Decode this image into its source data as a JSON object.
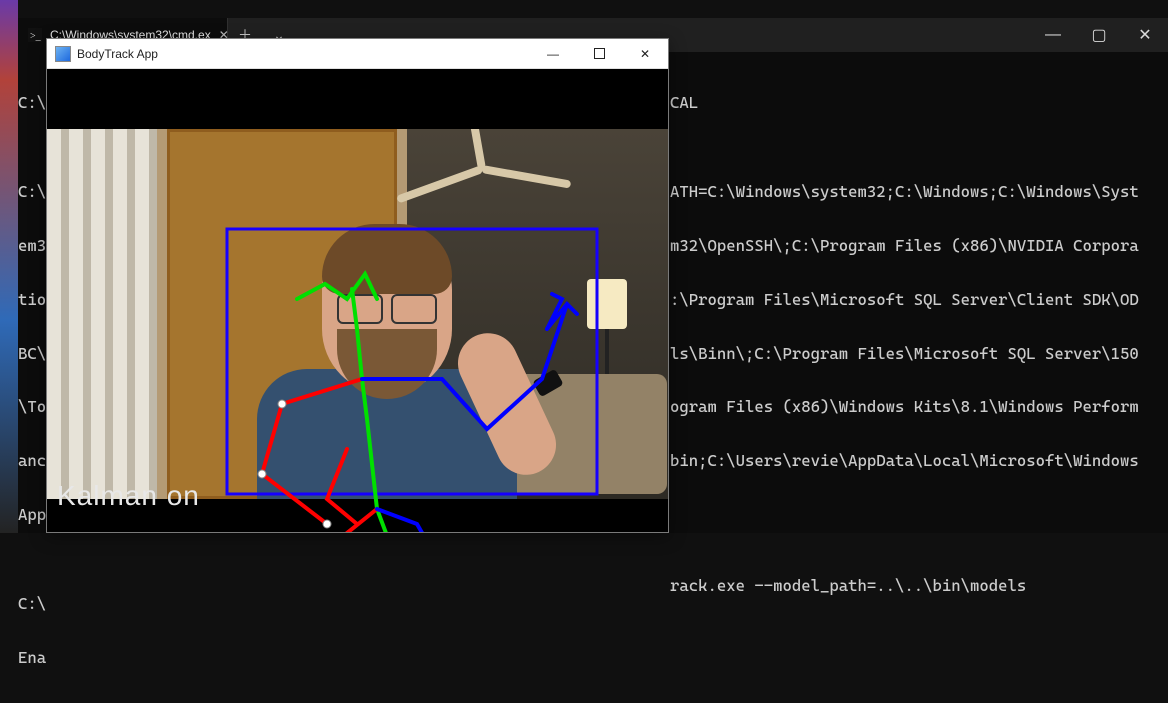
{
  "terminal": {
    "tab": {
      "icon": "cmd-icon",
      "title": "C:\\Windows\\system32\\cmd.ex"
    },
    "left_fragments": [
      "C:\\",
      "",
      "C:\\",
      "em3",
      "tio",
      "BC\\",
      "\\To",
      "anc",
      "App",
      "",
      "C:\\",
      "Ena"
    ],
    "right_fragments": [
      "CAL",
      "",
      "ATH=C:\\Windows\\system32;C:\\Windows;C:\\Windows\\Syst",
      "m32\\OpenSSH\\;C:\\Program Files (x86)\\NVIDIA Corpora",
      ":\\Program Files\\Microsoft SQL Server\\Client SDK\\OD",
      "ls\\Binn\\;C:\\Program Files\\Microsoft SQL Server\\150",
      "ogram Files (x86)\\Windows Kits\\8.1\\Windows Perform",
      "bin;C:\\Users\\revie\\AppData\\Local\\Microsoft\\Windows",
      "",
      "",
      "rack.exe --model_path=..\\..\\bin\\models",
      ""
    ]
  },
  "app": {
    "title": "BodyTrack App",
    "status_text": "Kalman on",
    "bbox_color": "#1600ff",
    "skel_colors": {
      "left": "#ff0000",
      "right": "#0000ff",
      "center": "#00e000"
    }
  },
  "window_controls": {
    "minimize": "—",
    "maximize": "▢",
    "close": "✕",
    "new_tab": "＋",
    "dropdown": "⌄"
  }
}
